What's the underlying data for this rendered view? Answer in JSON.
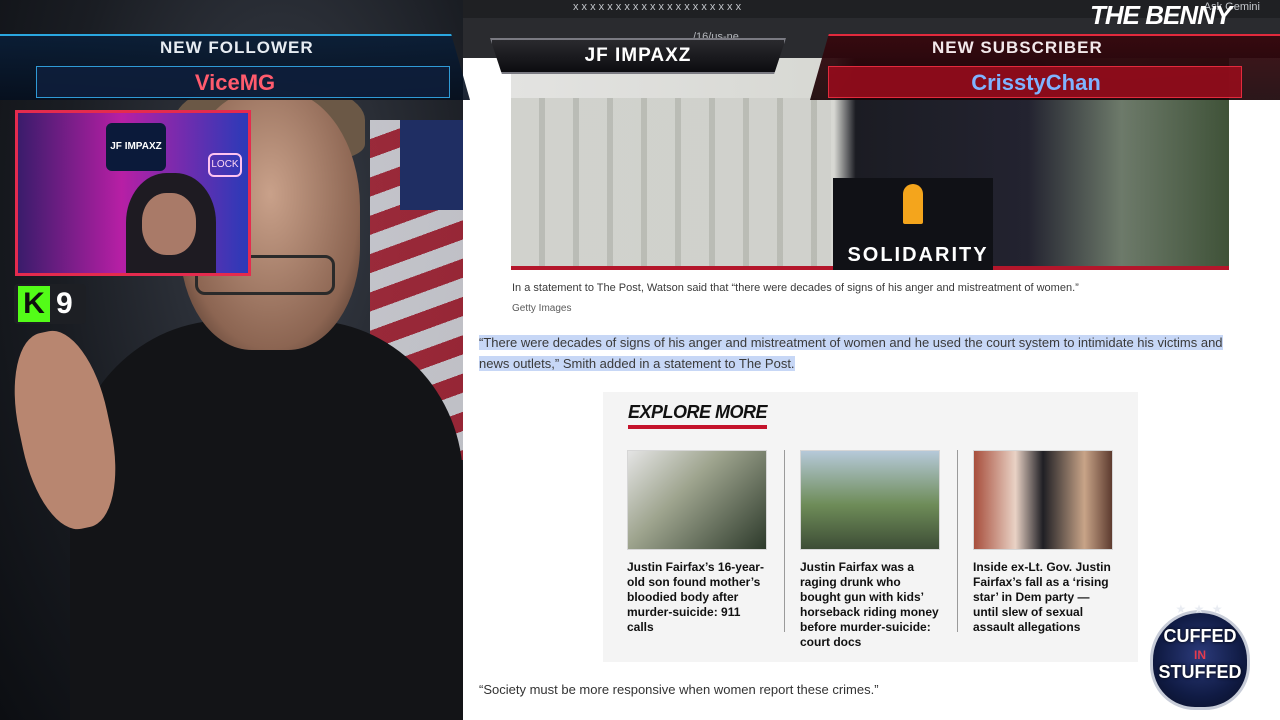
{
  "overlay": {
    "new_follower_label": "NEW FOLLOWER",
    "new_follower_name": "ViceMG",
    "streamer_name": "JF IMPAXZ",
    "new_subscriber_label": "NEW SUBSCRIBER",
    "new_subscriber_name": "CrisstyChan",
    "benny_logo": "THE BENNY",
    "kick_count": "9",
    "kick_icon_letter": "K",
    "inset_logo_text": "JF IMPAXZ",
    "inset_lock_text": "LOCK",
    "badge": {
      "text_top": "CUFFED",
      "text_mid": "IN",
      "text_bottom": "STUFFED",
      "stars": "★ ★ ★"
    }
  },
  "browser": {
    "url_fragment": "/16/us-ne",
    "ask_gemini": "Ask Gemini",
    "tab_icons": "x x x x x x x x x x x x x x x x x x x x"
  },
  "article": {
    "hero_text": "SOLIDARITY",
    "caption": "In a statement to The Post, Watson said that “there were decades of signs of his anger and mistreatment of women.”",
    "credit": "Getty Images",
    "quote_highlighted": "“There were decades of signs of his anger and mistreatment of women and he used the court system to intimidate his victims and news outlets,” Smith added in a statement to The Post.",
    "explore_title": "EXPLORE MORE",
    "explore_cards": [
      {
        "title": "Justin Fairfax’s 16-year-old son found mother’s bloodied body after murder-suicide: 911 calls"
      },
      {
        "title": "Justin Fairfax was a raging drunk who bought gun with kids’ horseback riding money before murder-suicide: court docs"
      },
      {
        "title": "Inside ex-Lt. Gov. Justin Fairfax’s fall as a ‘rising star’ in Dem party — until slew of sexual assault allegations"
      }
    ],
    "quote_bottom": "“Society must be more responsive when women report these crimes.”"
  },
  "colors": {
    "follower_accent": "#2aa7e0",
    "subscriber_accent": "#e22a3d",
    "highlight": "#c7d7f6",
    "explore_underline": "#c4132b"
  }
}
